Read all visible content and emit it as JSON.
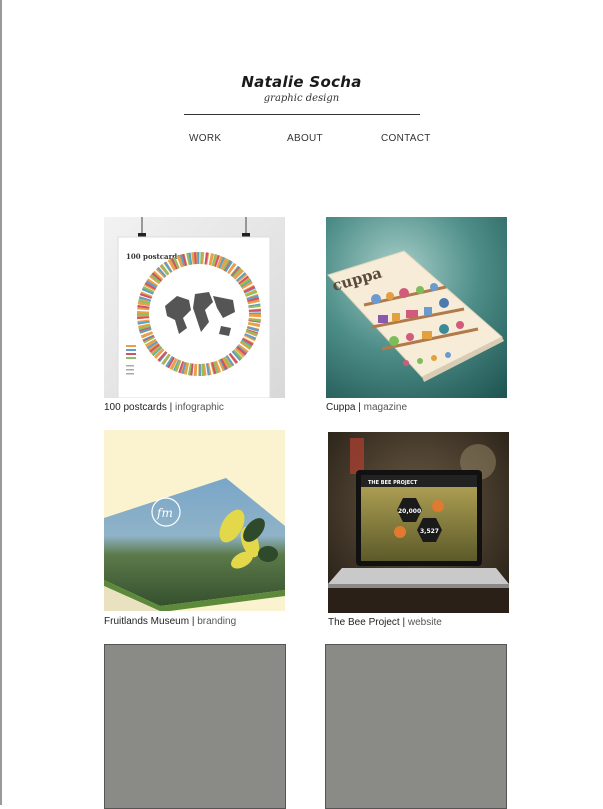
{
  "site": {
    "title": "Natalie Socha",
    "subtitle": "graphic design"
  },
  "nav": {
    "items": [
      {
        "label": "WORK"
      },
      {
        "label": "ABOUT"
      },
      {
        "label": "CONTACT"
      }
    ]
  },
  "portfolio": {
    "items": [
      {
        "title": "100 postcards",
        "category": "infographic",
        "thumb_text": "100 postcards"
      },
      {
        "title": "Cuppa",
        "category": "magazine",
        "thumb_text": "cuppa"
      },
      {
        "title": "Fruitlands Museum",
        "category": "branding",
        "thumb_text": "fm"
      },
      {
        "title": "The Bee Project",
        "category": "website",
        "thumb_text": "THE BEE PROJECT",
        "stat1": "20,000",
        "stat2": "3,527"
      }
    ],
    "separator": "|"
  },
  "colors": {
    "placeholder_gray": "#8a8a86",
    "cuppa_bg": "#3f7a76",
    "fm_bg": "#fbf3cf",
    "bee_bg": "#3a2e22"
  }
}
